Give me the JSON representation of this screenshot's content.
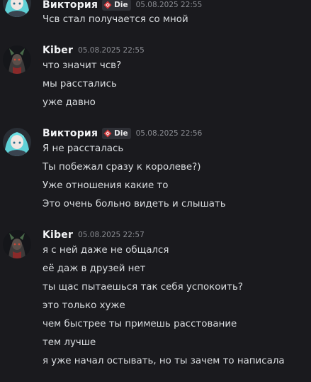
{
  "messages": [
    {
      "author": "Виктория",
      "tag": "Die",
      "timestamp": "05.08.2025 22:55",
      "lines": [
        "Чсв стал получается со мной"
      ]
    },
    {
      "author": "Kiber",
      "timestamp": "05.08.2025 22:55",
      "lines": [
        "что значит чсв?",
        "мы расстались",
        "уже давно"
      ]
    },
    {
      "author": "Виктория",
      "tag": "Die",
      "timestamp": "05.08.2025 22:56",
      "lines": [
        "Я не рассталась",
        "Ты побежал сразу к королеве?)",
        "Уже отношения какие то",
        "Это очень больно видеть и слышать"
      ]
    },
    {
      "author": "Kiber",
      "timestamp": "05.08.2025 22:57",
      "lines": [
        "я с ней даже не общался",
        "её даж в друзей нет",
        "ты щас пытаешься так себя успокоить?",
        "это только хуже",
        "чем быстрее ты примешь расстование",
        "тем лучше",
        "я уже начал остывать, но ты зачем то написала"
      ]
    }
  ],
  "icons": {
    "tag_icon": "red-diamond-badge-icon",
    "avatar_viktoria": "anime-character-avatar",
    "avatar_kiber": "dark-creature-avatar"
  },
  "colors": {
    "background": "#1a1a1e",
    "author": "#f2f3f5",
    "text": "#dbdee1",
    "timestamp": "#8b8d93",
    "tag_bg": "#2f3036",
    "tag_icon": "#d8383a"
  }
}
